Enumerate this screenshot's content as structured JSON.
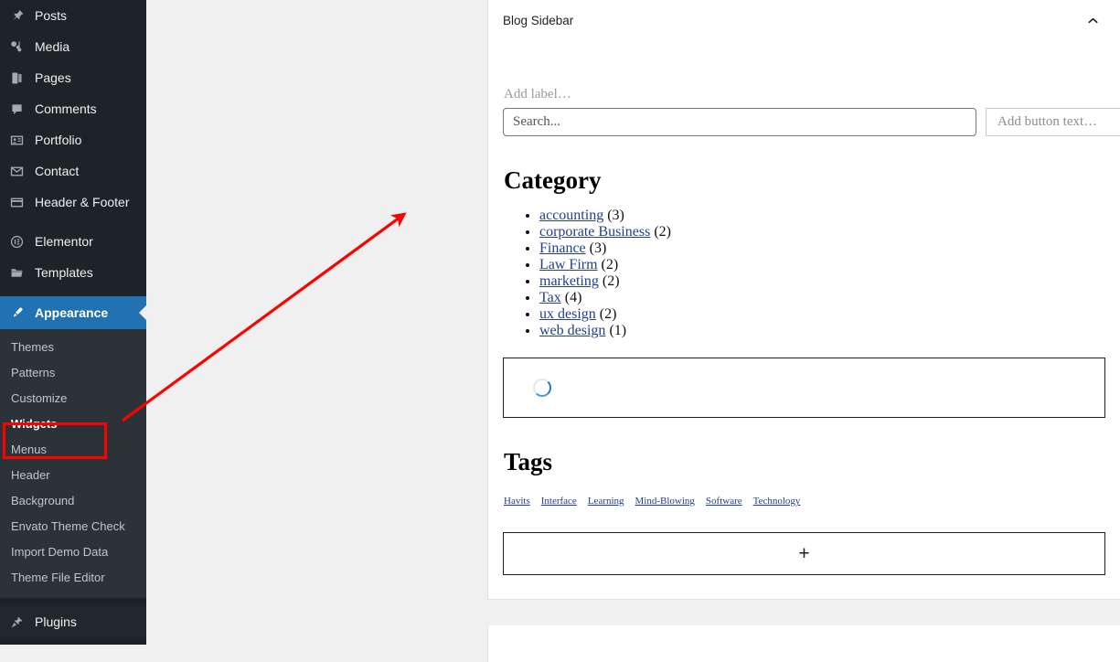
{
  "sidebar": {
    "items": [
      {
        "label": "Posts",
        "icon": "pin-icon",
        "type": "top"
      },
      {
        "label": "Media",
        "icon": "media-icon",
        "type": "top"
      },
      {
        "label": "Pages",
        "icon": "pages-icon",
        "type": "top"
      },
      {
        "label": "Comments",
        "icon": "comment-icon",
        "type": "top"
      },
      {
        "label": "Portfolio",
        "icon": "portfolio-icon",
        "type": "top"
      },
      {
        "label": "Contact",
        "icon": "envelope-icon",
        "type": "top"
      },
      {
        "label": "Header & Footer",
        "icon": "header-footer-icon",
        "type": "top"
      },
      {
        "label": "Elementor",
        "icon": "elementor-icon",
        "type": "top"
      },
      {
        "label": "Templates",
        "icon": "folder-icon",
        "type": "top"
      },
      {
        "label": "Appearance",
        "icon": "brush-icon",
        "type": "top-active"
      },
      {
        "label": "Plugins",
        "icon": "plug-icon",
        "type": "top"
      }
    ],
    "appearance_submenu": [
      {
        "label": "Themes",
        "current": false
      },
      {
        "label": "Patterns",
        "current": false
      },
      {
        "label": "Customize",
        "current": false
      },
      {
        "label": "Widgets",
        "current": true
      },
      {
        "label": "Menus",
        "current": false
      },
      {
        "label": "Header",
        "current": false
      },
      {
        "label": "Background",
        "current": false
      },
      {
        "label": "Envato Theme Check",
        "current": false
      },
      {
        "label": "Import Demo Data",
        "current": false
      },
      {
        "label": "Theme File Editor",
        "current": false
      }
    ],
    "colors": {
      "background": "#1d2327",
      "submenu_background": "#2c3338",
      "active": "#2271b1",
      "text": "#f0f0f1"
    }
  },
  "annotation": {
    "highlight_target": "Widgets",
    "color": "#ff0000"
  },
  "panel": {
    "title": "Blog Sidebar",
    "collapse_icon": "chevron-up-icon"
  },
  "search_widget": {
    "label_placeholder": "Add label…",
    "input_placeholder": "Search...",
    "button_placeholder": "Add button text…"
  },
  "category_widget": {
    "heading": "Category",
    "items": [
      {
        "name": "accounting",
        "count": "(3)"
      },
      {
        "name": "corporate Business",
        "count": "(2)"
      },
      {
        "name": "Finance",
        "count": "(3)"
      },
      {
        "name": "Law Firm",
        "count": "(2)"
      },
      {
        "name": "marketing",
        "count": "(2)"
      },
      {
        "name": "Tax",
        "count": "(4)"
      },
      {
        "name": "ux design",
        "count": "(2)"
      },
      {
        "name": "web design",
        "count": "(1)"
      }
    ],
    "link_color": "#22408c"
  },
  "loading_widget": {
    "state": "loading",
    "spinner_color": "#1c7fc4"
  },
  "tags_widget": {
    "heading": "Tags",
    "tags": [
      "Havits",
      "Interface",
      "Learning",
      "Mind-Blowing",
      "Software",
      "Technology"
    ],
    "link_color": "#22408c"
  },
  "add_block": {
    "icon": "plus-icon",
    "glyph": "+"
  }
}
